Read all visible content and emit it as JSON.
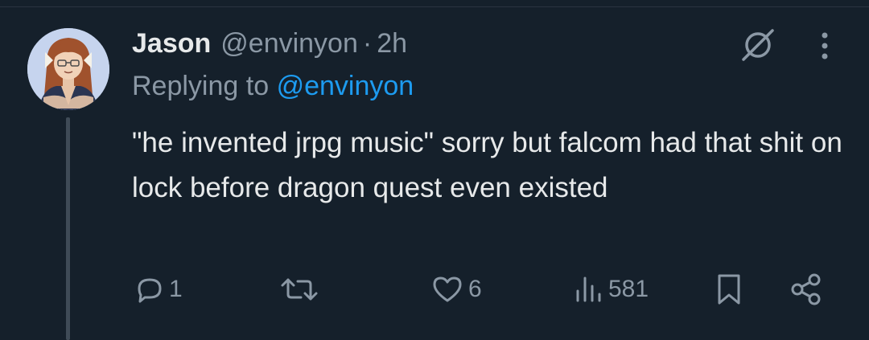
{
  "author": {
    "display_name": "Jason",
    "handle": "@envinyon",
    "separator": "·",
    "time": "2h"
  },
  "reply": {
    "prefix": "Replying to",
    "mention": "@envinyon"
  },
  "tweet": {
    "text": "\"he invented jrpg music\" sorry but falcom had that shit on lock before dragon quest even existed"
  },
  "actions": {
    "reply_count": "1",
    "retweet_count": "",
    "like_count": "6",
    "view_count": "581"
  },
  "icons": {
    "grok": "grok-icon",
    "more": "more-vertical-icon",
    "reply": "reply-icon",
    "retweet": "retweet-icon",
    "like": "heart-icon",
    "views": "views-icon",
    "bookmark": "bookmark-icon",
    "share": "share-icon"
  },
  "colors": {
    "background": "#15202b",
    "text_primary": "#e7e9ea",
    "text_secondary": "#8b98a5",
    "accent": "#1d9bf0"
  }
}
